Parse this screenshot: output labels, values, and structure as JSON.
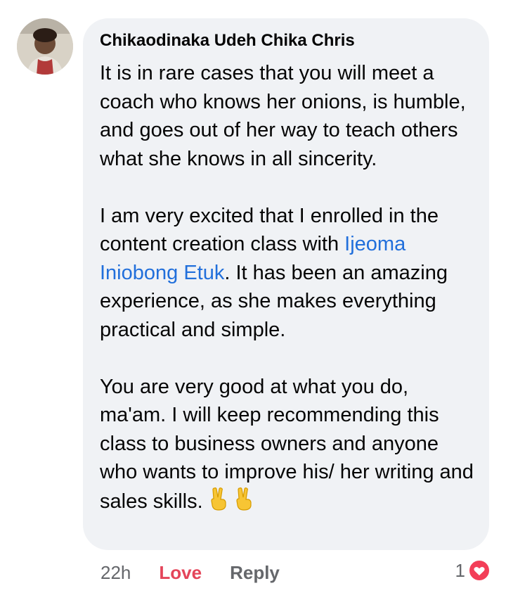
{
  "comment": {
    "author": "Chikaodinaka Udeh Chika Chris",
    "paragraph1": "It is in rare cases that you will meet a coach who knows her onions, is humble, and goes out of her way to teach others what she knows in all sincerity.",
    "paragraph2_before": "I am very excited that I enrolled in the content creation class with ",
    "mention": "Ijeoma Iniobong Etuk",
    "paragraph2_after": ". It has been an amazing experience, as she makes everything practical and simple.",
    "paragraph3": "You are very good at what you do, ma'am. I will keep recommending this class to business owners and anyone who wants to improve his/ her writing and sales skills.",
    "emojis": [
      "victory-hand-icon",
      "victory-hand-icon"
    ]
  },
  "actions": {
    "time": "22h",
    "love_label": "Love",
    "reply_label": "Reply"
  },
  "reactions": {
    "count": "1",
    "icon": "love-reaction-icon"
  },
  "colors": {
    "bubble": "#f0f2f5",
    "mention": "#216fdb",
    "love": "#e4455a",
    "muted": "#65676b"
  }
}
